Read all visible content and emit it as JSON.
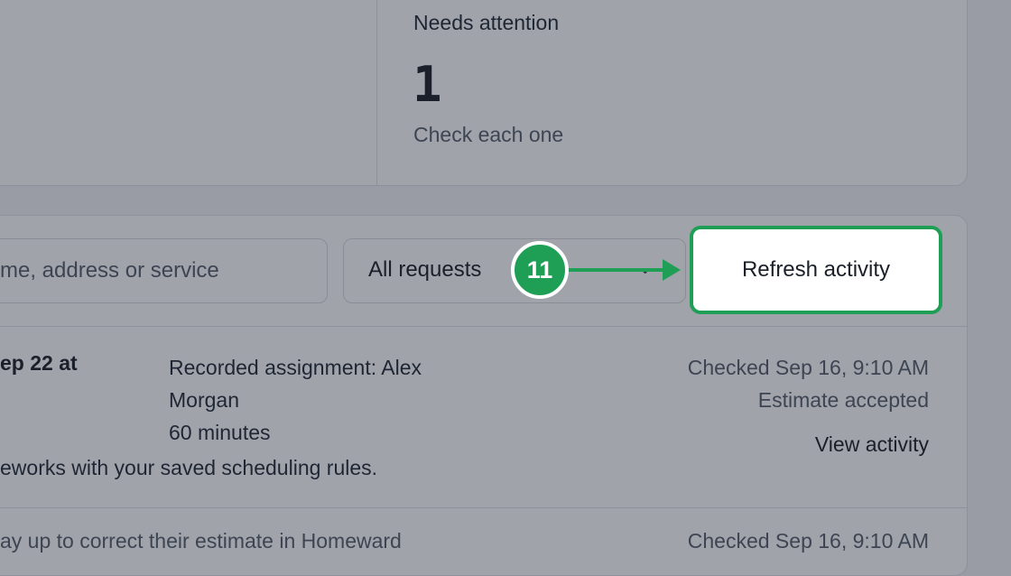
{
  "stats": {
    "needs_attention_title": "Needs attention",
    "needs_attention_value": "1",
    "needs_attention_sub": "Check each one"
  },
  "toolbar": {
    "search_placeholder": "me, address or service",
    "filter_label": "All requests",
    "refresh_label": "Refresh activity"
  },
  "annotation": {
    "step": "11",
    "accent": "#1f9f55"
  },
  "rows": [
    {
      "date": "ep 22 at",
      "assignment_line1": "Recorded assignment: Alex",
      "assignment_line2": "Morgan",
      "duration": "60 minutes",
      "checked": "Checked Sep 16, 9:10 AM",
      "status": "Estimate accepted",
      "action": "View activity",
      "note": "eworks with your saved scheduling rules."
    },
    {
      "partial_text": "ay up to correct their estimate in Homeward",
      "checked": "Checked Sep 16, 9:10 AM"
    }
  ]
}
